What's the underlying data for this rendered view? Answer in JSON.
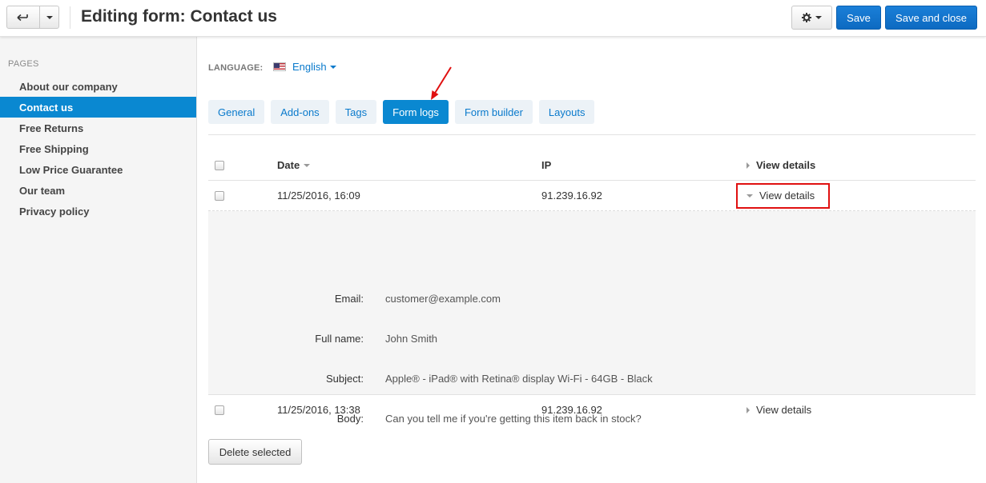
{
  "header": {
    "title": "Editing form: Contact us",
    "save_label": "Save",
    "save_close_label": "Save and close",
    "icons": {
      "back": "back-arrow-icon",
      "settings": "gear-icon"
    }
  },
  "sidebar": {
    "heading": "PAGES",
    "items": [
      {
        "label": "About our company",
        "active": false
      },
      {
        "label": "Contact us",
        "active": true
      },
      {
        "label": "Free Returns",
        "active": false
      },
      {
        "label": "Free Shipping",
        "active": false
      },
      {
        "label": "Low Price Guarantee",
        "active": false
      },
      {
        "label": "Our team",
        "active": false
      },
      {
        "label": "Privacy policy",
        "active": false
      }
    ]
  },
  "language": {
    "label": "LANGUAGE:",
    "value": "English",
    "flag_icon": "us-flag-icon"
  },
  "tabs": [
    {
      "label": "General",
      "active": false
    },
    {
      "label": "Add-ons",
      "active": false
    },
    {
      "label": "Tags",
      "active": false
    },
    {
      "label": "Form logs",
      "active": true
    },
    {
      "label": "Form builder",
      "active": false
    },
    {
      "label": "Layouts",
      "active": false
    }
  ],
  "table": {
    "headers": {
      "date": "Date",
      "ip": "IP",
      "view": "View details"
    },
    "rows": [
      {
        "date": "11/25/2016, 16:09",
        "ip": "91.239.16.92",
        "view": "View details",
        "expanded": true,
        "details": [
          {
            "label": "Email:",
            "value": "customer@example.com"
          },
          {
            "label": "Full name:",
            "value": "John Smith"
          },
          {
            "label": "Subject:",
            "value": "Apple® - iPad® with Retina® display Wi-Fi - 64GB - Black"
          },
          {
            "label": "Body:",
            "value": "Can you tell me if you're getting this item back in stock?"
          }
        ]
      },
      {
        "date": "11/25/2016, 13:38",
        "ip": "91.239.16.92",
        "view": "View details",
        "expanded": false
      }
    ]
  },
  "footer": {
    "delete_label": "Delete selected"
  },
  "colors": {
    "accent": "#0a88d1",
    "primary_button": "#1a7fd8",
    "annotation_red": "#e01010"
  }
}
